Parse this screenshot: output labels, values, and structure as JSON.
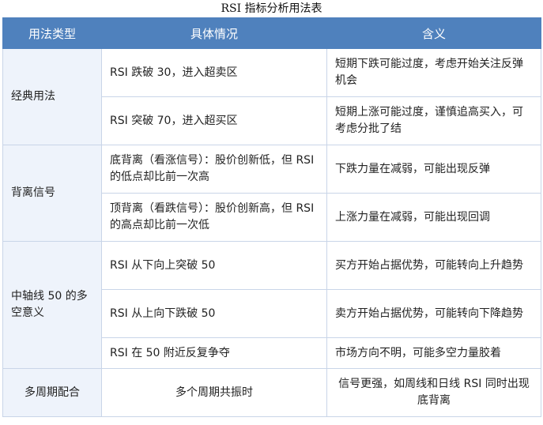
{
  "caption": "RSI 指标分析用法表",
  "headers": [
    "用法类型",
    "具体情况",
    "含义"
  ],
  "groups": [
    {
      "category": "经典用法",
      "rows": [
        {
          "situation": "RSI 跌破 30，进入超卖区",
          "meaning": "短期下跌可能过度，考虑开始关注反弹机会"
        },
        {
          "situation": "RSI 突破 70，进入超买区",
          "meaning": "短期上涨可能过度，谨慎追高买入，可考虑分批了结"
        }
      ]
    },
    {
      "category": "背离信号",
      "rows": [
        {
          "situation": "底背离（看涨信号）：股价创新低，但 RSI 的低点却比前一次高",
          "meaning": "下跌力量在减弱，可能出现反弹"
        },
        {
          "situation": "顶背离（看跌信号）：股价创新高，但 RSI 的高点却比前一次低",
          "meaning": "上涨力量在减弱，可能出现回调"
        }
      ]
    },
    {
      "category": "中轴线 50 的多空意义",
      "rows": [
        {
          "situation": "RSI 从下向上突破 50",
          "meaning": "买方开始占据优势，可能转向上升趋势"
        },
        {
          "situation": "RSI 从上向下跌破 50",
          "meaning": "卖方开始占据优势，可能转向下降趋势"
        },
        {
          "situation": "RSI 在 50 附近反复争夺",
          "meaning": "市场方向不明，可能多空力量胶着"
        }
      ]
    },
    {
      "category": "多周期配合",
      "rows": [
        {
          "situation": "多个周期共振时",
          "meaning": "信号更强，如周线和日线 RSI 同时出现底背离"
        }
      ]
    }
  ]
}
